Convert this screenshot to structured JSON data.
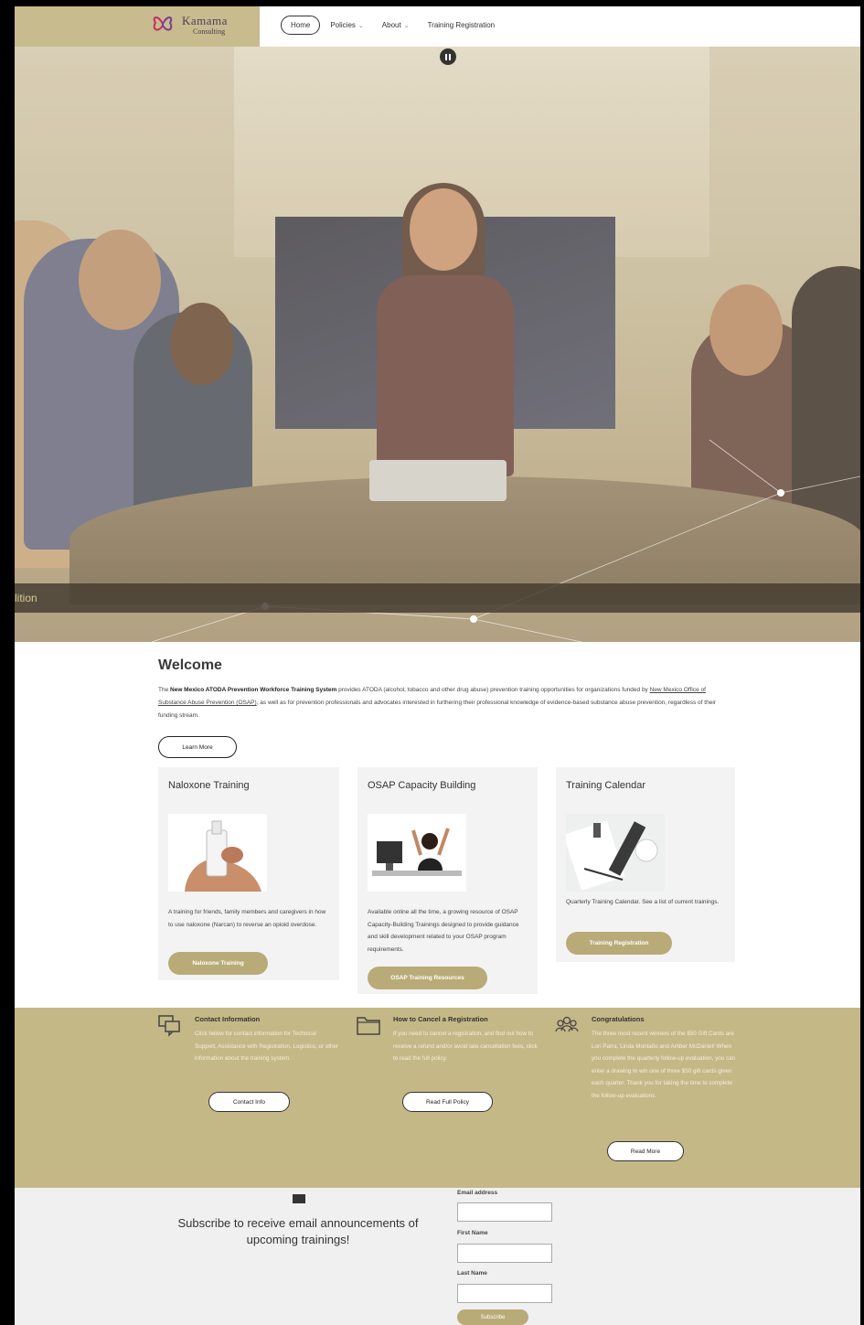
{
  "brand": {
    "name_line1": "Kamama",
    "name_line2": "Consulting",
    "color": "#c8bb8e"
  },
  "nav": {
    "items": [
      {
        "label": "Home",
        "active": true
      },
      {
        "label": "Policies",
        "has_dropdown": true
      },
      {
        "label": "About",
        "has_dropdown": true
      },
      {
        "label": "Training Registration"
      }
    ]
  },
  "hero": {
    "caption": "lition",
    "pause_icon": "pause-icon"
  },
  "welcome": {
    "title": "Welcome",
    "p_pre": "The ",
    "p_bold": "New Mexico ATODA Prevention Workforce Training System",
    "p_mid": " provides ATODA (alcohol, tobacco and other drug abuse) prevention training opportunities for organizations funded by ",
    "p_link": "New Mexico Office of Substance Abuse Prevention (OSAP)",
    "p_post": ", as well as for prevention professionals and advocates interested in furthering their professional knowledge of evidence-based substance abuse prevention, regardless of their funding stream.",
    "learn_more": "Learn More"
  },
  "cards": [
    {
      "title": "Naloxone Training",
      "description": "A training for friends, family members and caregivers in how to use naloxone (Narcan) to reverse an opioid overdose.",
      "button": "Naloxone Training"
    },
    {
      "title": "OSAP Capacity Building",
      "description": "Available online all the time, a growing resource of OSAP Capacity-Building Trainings designed to provide guidance and skill development related to your OSAP program requirements.",
      "button": "OSAP Training Resources"
    },
    {
      "title": "Training Calendar",
      "description": "Quarterly Training Calendar. See a list of current trainings.",
      "button": "Training Registration"
    }
  ],
  "info": [
    {
      "title": "Contact Information",
      "text": "Click below for contact information for Technical Support, Assistance with Registration, Logistics, or other information about the training system.",
      "button": "Contact Info",
      "icon": "chat-icon"
    },
    {
      "title": "How to Cancel a Registration",
      "text": "If you need to cancel a registration, and find out how to receive a refund and/or avoid late cancellation fees, click to read the full policy.",
      "button": "Read Full Policy",
      "icon": "folder-icon"
    },
    {
      "title": "Congratulations",
      "text": "The three most recent winners of the $50 Gift Cards are Lori Parra, Linda Montaño and Amber McDaniel! When you complete the quarterly follow-up evaluation, you can enter a drawing to win one of three $50 gift cards given each quarter. Thank you for taking the time to complete the follow-up evaluations.",
      "button": "Read More",
      "icon": "group-icon"
    }
  ],
  "subscribe": {
    "icon": "mail-icon",
    "text": "Subscribe to receive email announcements of upcoming trainings!",
    "email_label": "Email address",
    "first_label": "First Name",
    "last_label": "Last Name",
    "button": "Subscribe"
  }
}
